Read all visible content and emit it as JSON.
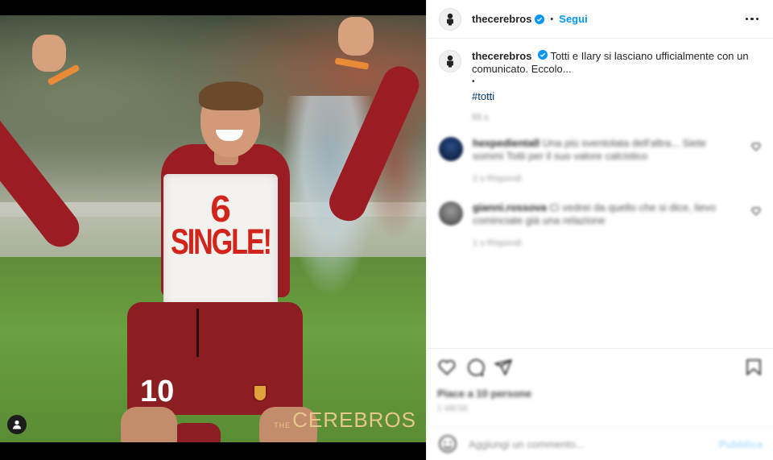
{
  "post": {
    "username": "thecerebros",
    "follow_label": "Segui",
    "separator": "•",
    "caption_text": "Totti e Ilary si lasciano ufficialmente con un comunicato. Eccolo...",
    "caption_dot": "•",
    "hashtag": "#totti",
    "caption_time": "55 s",
    "verified_color": "#0095f6",
    "accent_color": "#0095f6"
  },
  "image": {
    "shirt_number": "6",
    "shirt_text": "SINGLE!",
    "shorts_number": "10",
    "watermark_the": "THE",
    "watermark_brand": "CEREBROS"
  },
  "comments": [
    {
      "username": "hexpedientall",
      "text": "Una più sventolata dell'altra... Siete sommi Totti per il suo valore calcistico",
      "meta": "2 s   Rispondi"
    },
    {
      "username": "gianni.rossova",
      "text": "Ci vedrei da quello che si dice, lievo cominciate già una relazione",
      "meta": "1 s   Rispondi"
    }
  ],
  "footer": {
    "likes": "Piace a 10 persone",
    "date": "1 MESE",
    "comment_placeholder": "Aggiungi un commento...",
    "publish_label": "Pubblica"
  },
  "icons": [
    "heart-icon",
    "comment-icon",
    "share-icon",
    "bookmark-icon",
    "emoji-icon",
    "more-options-icon",
    "verified-icon",
    "profile-icon"
  ]
}
